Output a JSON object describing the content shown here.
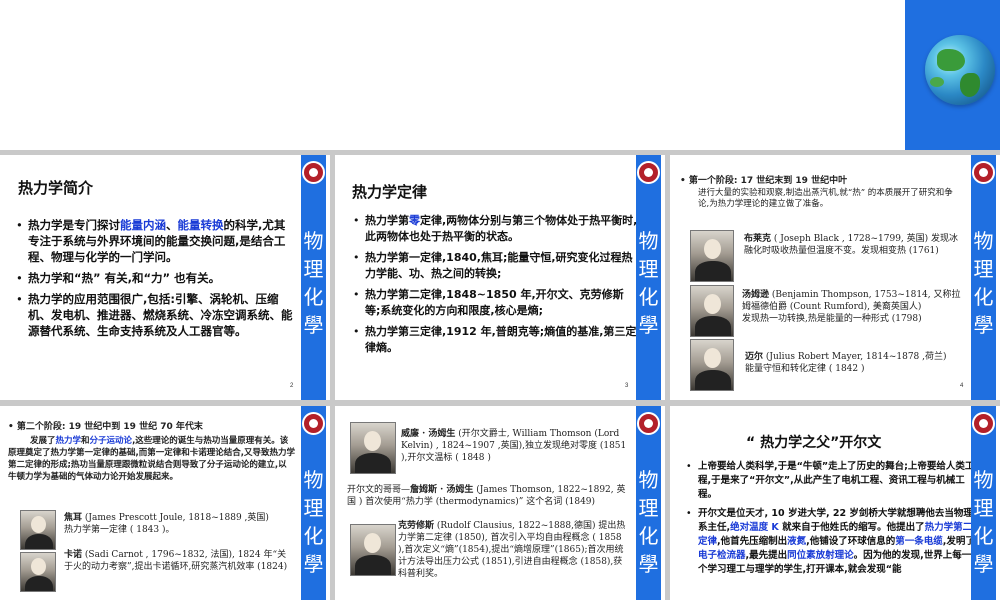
{
  "slide1": {
    "title": "热力学简介",
    "b1_pre": "热力学是专门探讨",
    "b1_hl1": "能量内涵",
    "b1_sep": "、",
    "b1_hl2": "能量转换",
    "b1_post": "的科学,尤其专注于系统与外界环境间的能量交换问题,是结合工程、物理与化学的一门学问。",
    "b2": "热力学和“热” 有关,和“力” 也有关。",
    "b3": "热力学的应用范围很广,包括:引擎、涡轮机、压缩机、发电机、推进器、燃烧系统、冷冻空调系统、能源替代系统、生命支持系统及人工器官等。",
    "page": "2"
  },
  "slide2": {
    "title": "热力学定律",
    "b1_pre": "热力学第",
    "b1_hl": "零",
    "b1_post": "定律,两物体分别与第三个物体处于热平衡时,此两物体也处于热平衡的状态。",
    "b2": "热力学第一定律,1840,焦耳;能量守恒,研究变化过程热力学能、功、热之间的转换;",
    "b3": "热力学第二定律,1848~1850 年,开尔文、克劳修斯等;系统变化的方向和限度,核心是熵;",
    "b4": "热力学第三定律,1912 年,普朗克等;熵值的基准,第三定律熵。",
    "page": "3"
  },
  "slide3": {
    "stage": "第一个阶段: 17 世纪末到 19 世纪中叶",
    "intro": "进行大量的实验和观察,制造出蒸汽机,就“热” 的本质展开了研究和争论,为热力学理论的建立做了准备。",
    "p1_name": "布莱克",
    "p1_info": "( Joseph Black , 1728~1799, 英国) 发现冰融化时吸收热量但温度不变。发现相变热 (1761)",
    "p2_name": "汤姆逊",
    "p2_info": "(Benjamin Thompson, 1753~1814, 又称拉姆福德伯爵 (Count Rumford), 美裔英国人)",
    "p2_desc": "发现热一功转换,热是能量的一种形式 (1798)",
    "p3_name": "迈尔",
    "p3_info": "(Julius Robert Mayer, 1814~1878 ,荷兰)",
    "p3_desc": "能量守恒和转化定律 ( 1842 )",
    "page": "4"
  },
  "slide4": {
    "stage": "第二个阶段: 19 世纪中到 19 世纪 70 年代末",
    "intro_pre": "发展了",
    "intro_hl1": "热力学",
    "intro_mid": "和",
    "intro_hl2": "分子运动论",
    "intro_post": ",这些理论的诞生与热功当量原理有关。该原理奠定了热力学第一定律的基础,而第一定律和卡诺理论结合,又导致热力学第二定律的形成;热功当量原理跟微粒说结合则导致了分子运动论的建立,以牛顿力学为基础的气体动力论开始发展起来。",
    "p1_name": "焦耳",
    "p1_info": "(James Prescott Joule, 1818~1889 ,英国)",
    "p1_desc": "热力学第一定律 ( 1843 )。",
    "p2_name": "卡诺",
    "p2_info": "(Sadi Carnot , 1796~1832, 法国), 1824 年“关于火的动力考察”,提出卡诺循环,研究蒸汽机效率 (1824)"
  },
  "slide5": {
    "p1_name": "威廉 · 汤姆生",
    "p1_info": "(开尔文爵士, William Thomson (Lord Kelvin) , 1824~1907 ,英国),独立发现绝对零度 (1851 ),开尔文温标 ( 1848 )",
    "brother_pre": "开尔文的哥哥—",
    "brother_name": "詹姆斯 · 汤姆生",
    "brother_post": "(James Thomson, 1822~1892, 英国 ) 首次使用“热力学 (thermodynamics)” 这个名词 (1849)",
    "p2_name": "克劳修斯",
    "p2_info": "(Rudolf Clausius, 1822~1888,德国) 提出热力学第二定律 (1850), 首次引入平均自由程概念 ( 1858 ),首次定义“熵”(1854),提出“熵增原理”(1865);首次用统计方法导出压力公式 (1851),引进自由程概念 (1858),获科普利奖。"
  },
  "slide6": {
    "title": "“ 热力学之父”开尔文",
    "b1": "上帝要给人类科学,于是“牛顿”走上了历史的舞台;上帝要给人类工程,于是来了“开尔文”,从此产生了电机工程、资讯工程与机械工程。",
    "b2_a": "开尔文是位天才, 10 岁进大学, 22 岁剑桥大学就想聘他去当物理系主任,",
    "b2_hl1": "绝对温度 K",
    "b2_b": " 就来自于他姓氏的缩写。他提出了",
    "b2_hl2": "热力学第二定律",
    "b2_c": ",他首先压缩制出",
    "b2_hl3": "液氮",
    "b2_d": ",他铺设了环球信息的",
    "b2_hl4": "第一条电缆",
    "b2_e": ",发明了",
    "b2_hl5": "电子检流器",
    "b2_f": ",最先提出",
    "b2_hl6": "同位素放射理论",
    "b2_g": "。因为他的发现,世界上每一个学习理工与理学的学生,打开课本,就会发现“能"
  },
  "sidebar_chars": [
    "物",
    "理",
    "化",
    "學"
  ],
  "colors": {
    "accent": "#1f6fe0",
    "highlight": "#1a3bd6",
    "seal": "#b3202a"
  }
}
